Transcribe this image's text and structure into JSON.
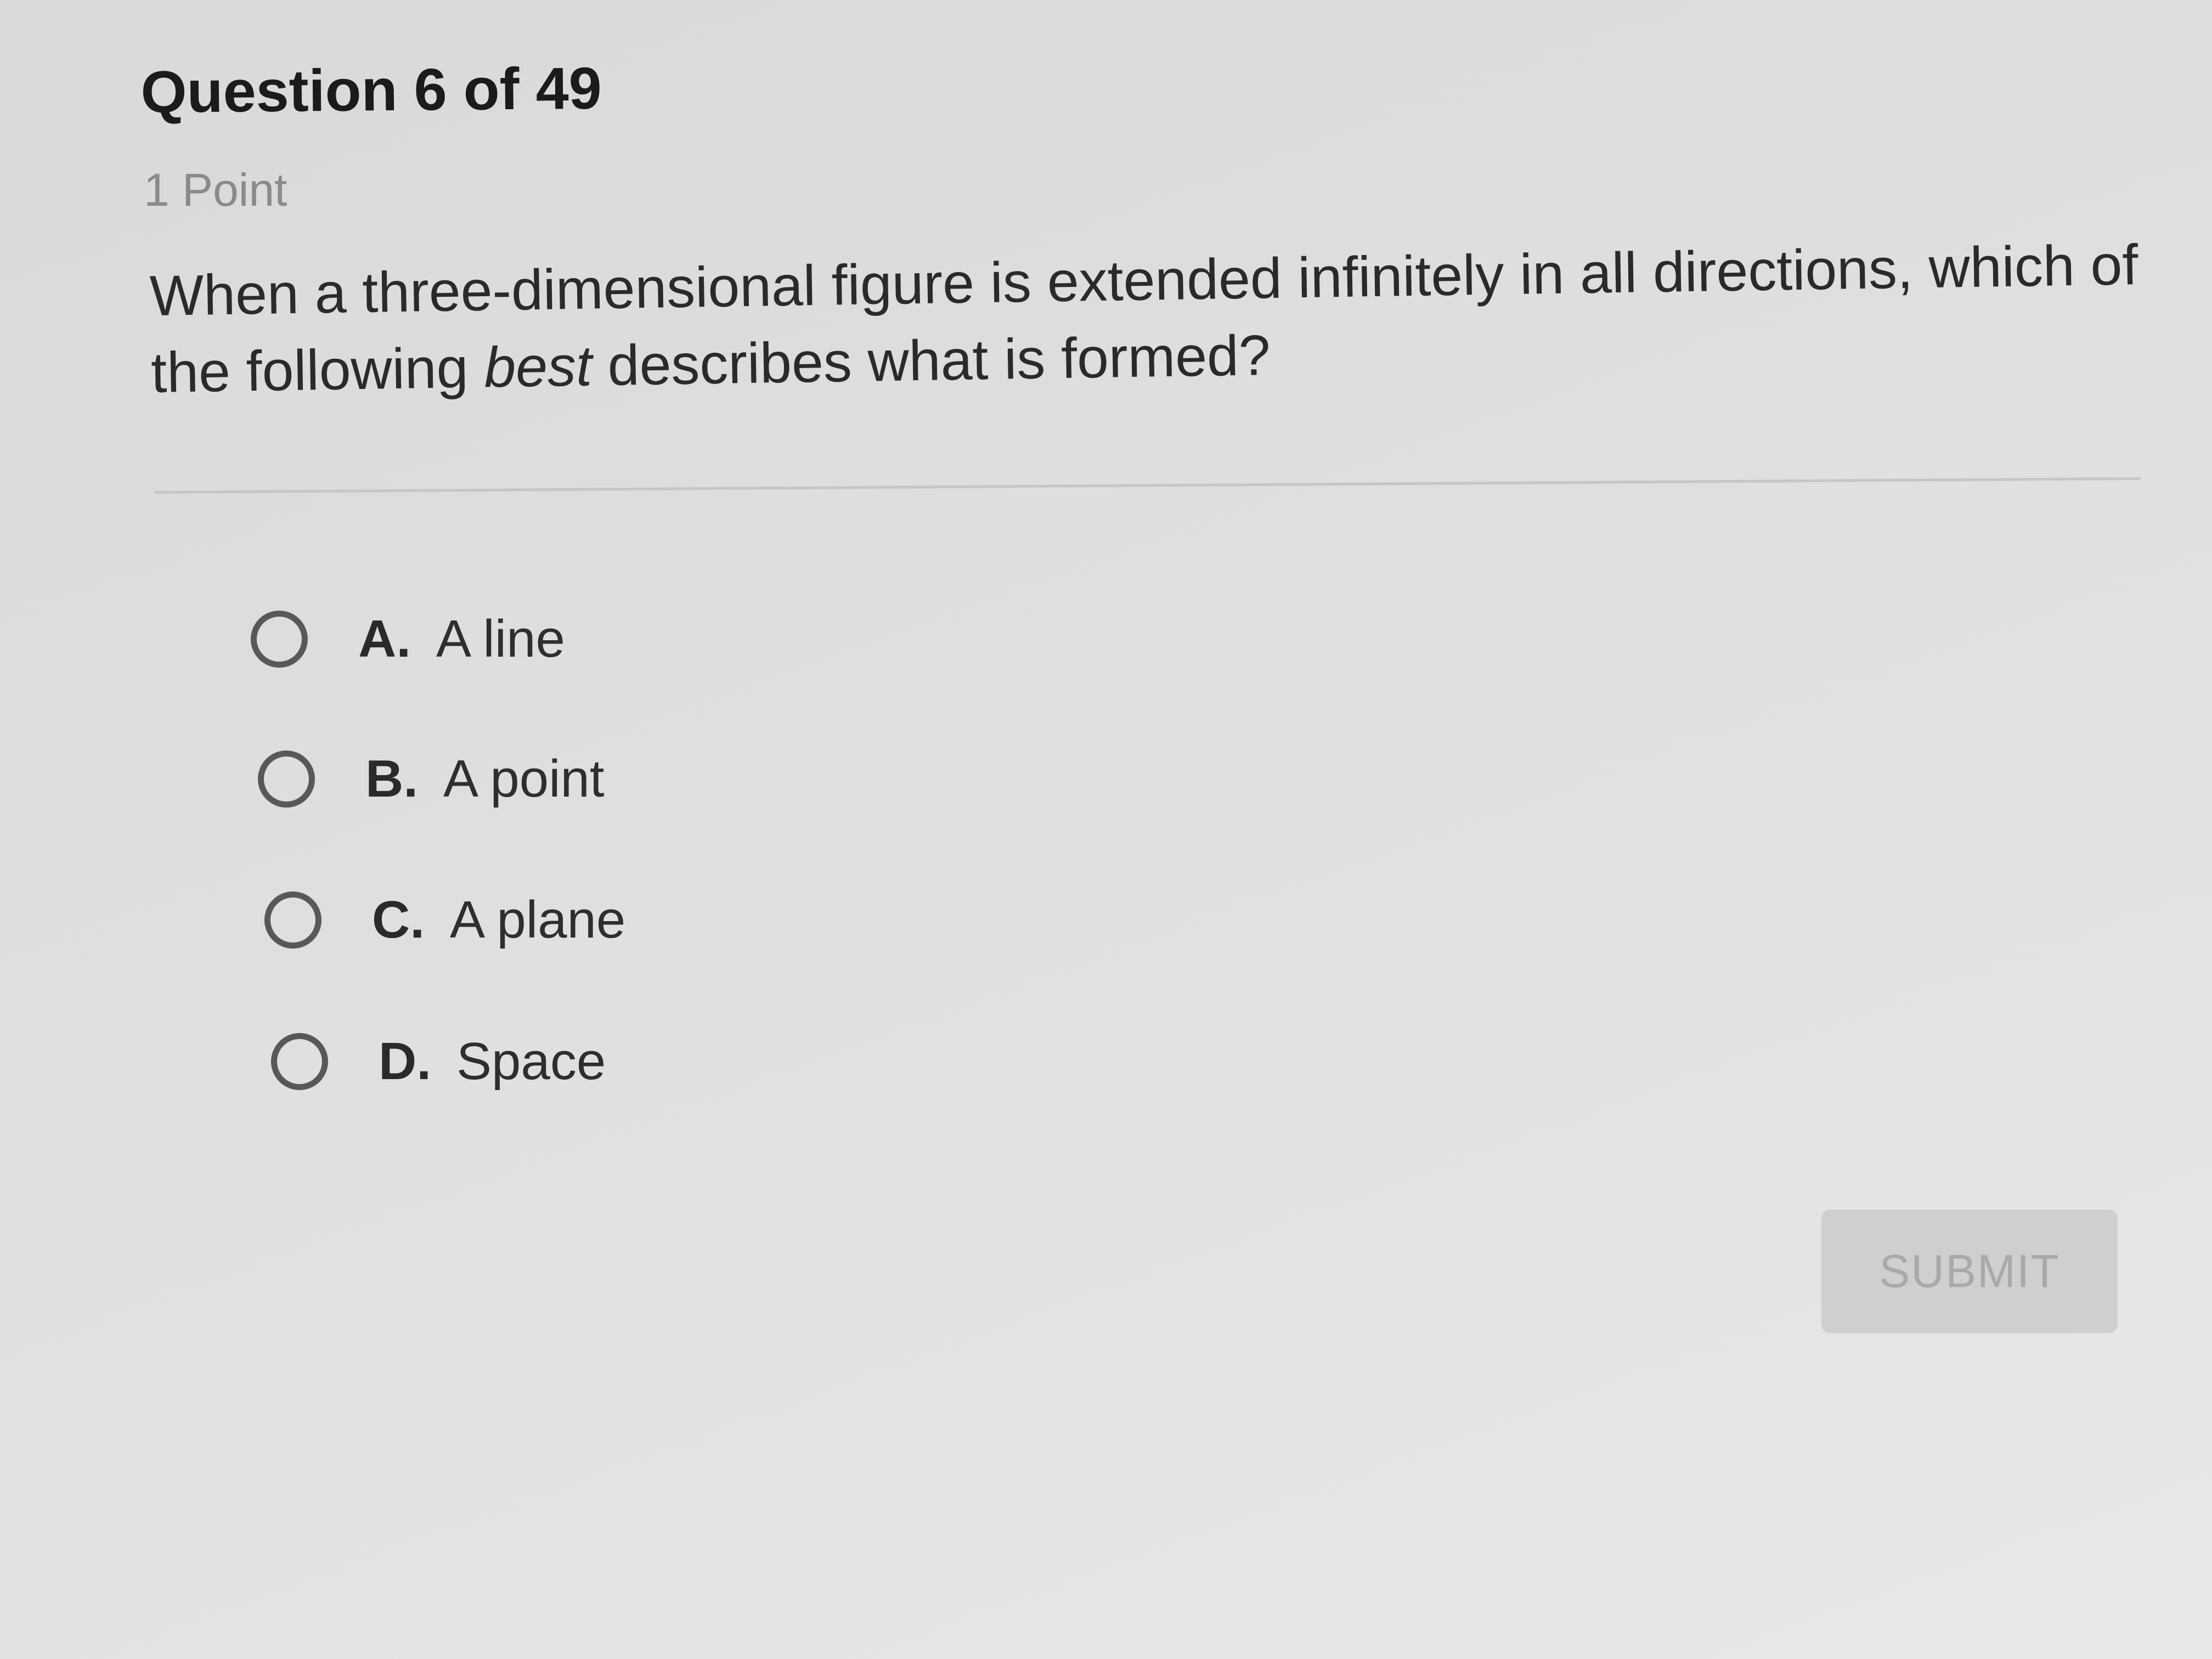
{
  "question": {
    "title": "Question 6 of 49",
    "points": "1 Point",
    "prompt_before": "When a three-dimensional figure is extended infinitely in all directions, which of the following ",
    "prompt_emphasis": "best",
    "prompt_after": " describes what is formed?"
  },
  "options": [
    {
      "letter": "A.",
      "text": "A line",
      "selected": false
    },
    {
      "letter": "B.",
      "text": "A point",
      "selected": false
    },
    {
      "letter": "C.",
      "text": "A plane",
      "selected": false
    },
    {
      "letter": "D.",
      "text": "Space",
      "selected": false
    }
  ],
  "submit": {
    "label": "SUBMIT",
    "enabled": false
  },
  "colors": {
    "background": "#dedede",
    "text": "#2a2a2a",
    "muted": "#8a8a8a",
    "submit_bg": "#cfcfcf",
    "submit_text": "#a9a9a9"
  }
}
